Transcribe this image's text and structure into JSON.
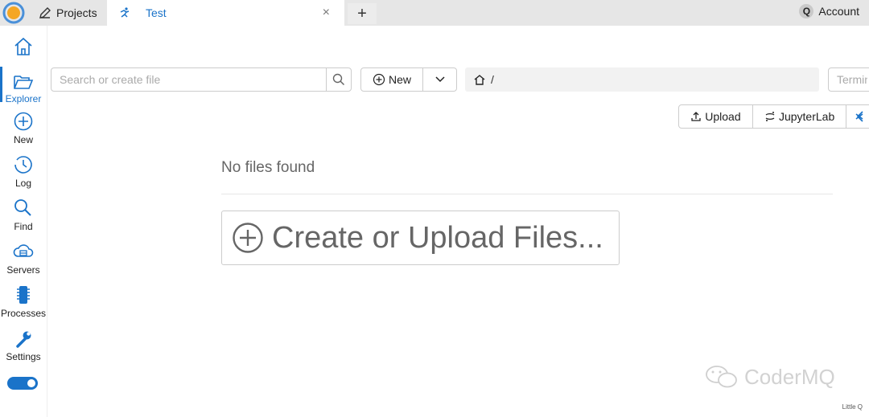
{
  "tabs": {
    "projects_label": "Projects",
    "active_label": "Test",
    "close_glyph": "×",
    "add_glyph": "+"
  },
  "account": {
    "initial": "Q",
    "label": "Account"
  },
  "sidebar": {
    "items": [
      {
        "label": "",
        "icon": "home-icon"
      },
      {
        "label": "Explorer",
        "icon": "folder-open-icon",
        "active": true
      },
      {
        "label": "New",
        "icon": "plus-circle-icon"
      },
      {
        "label": "Log",
        "icon": "history-icon"
      },
      {
        "label": "Find",
        "icon": "search-icon"
      },
      {
        "label": "Servers",
        "icon": "cloud-server-icon"
      },
      {
        "label": "Processes",
        "icon": "chip-icon"
      },
      {
        "label": "Settings",
        "icon": "wrench-icon"
      }
    ]
  },
  "toolbar": {
    "search_placeholder": "Search or create file",
    "new_label": "New",
    "path": "/",
    "terminal_placeholder": "Terminal command..."
  },
  "actions": {
    "upload_label": "Upload",
    "jupyter_label": "JupyterLab"
  },
  "main": {
    "empty_text": "No files found",
    "create_label": "Create or Upload Files..."
  },
  "watermark": {
    "text": "CoderMQ",
    "small": "Little Q"
  },
  "colors": {
    "accent": "#1a73c9",
    "topbar": "#e6e6e6",
    "path_bg": "#f2f2f2"
  }
}
